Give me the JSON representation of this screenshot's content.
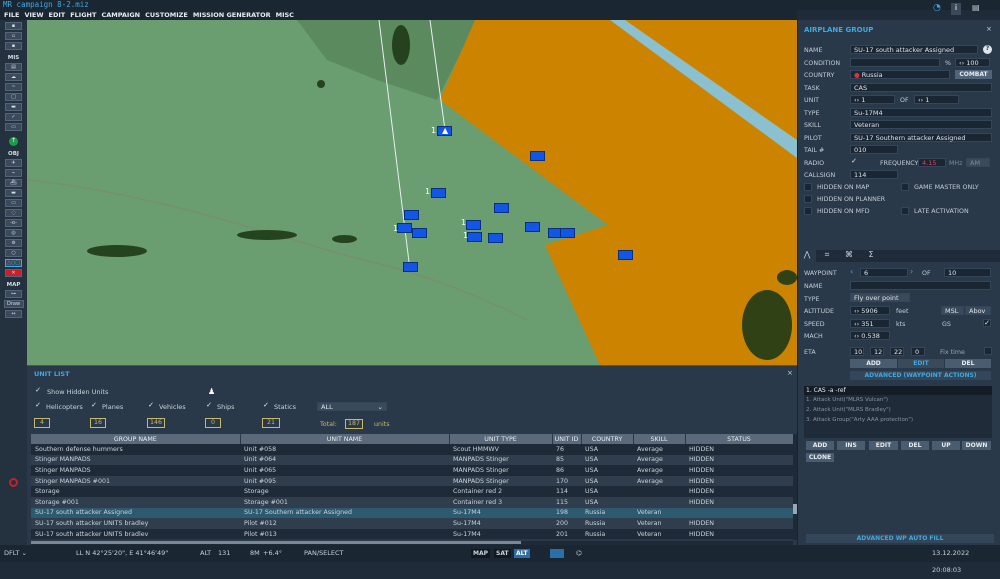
{
  "title": "MR campaign 8-2.miz",
  "menu": [
    "FILE",
    "VIEW",
    "EDIT",
    "FLIGHT",
    "CAMPAIGN",
    "CUSTOMIZE",
    "MISSION GENERATOR",
    "MISC"
  ],
  "toolbar": {
    "mis": "MIS",
    "obj": "OBJ",
    "map": "MAP",
    "draw": "Draw"
  },
  "map": {
    "marker_label": "1"
  },
  "colors": {
    "map_green": "#6a9d6f",
    "enemy_zone": "#cc8400",
    "unit_blue": "#1256e6",
    "accent": "#3fa9e0"
  },
  "unit_list": {
    "title": "UNIT LIST",
    "show_hidden": "Show Hidden Units",
    "filters": [
      {
        "label": "Helicopters",
        "count": "4"
      },
      {
        "label": "Planes",
        "count": "16"
      },
      {
        "label": "Vehicles",
        "count": "146"
      },
      {
        "label": "Ships",
        "count": "0"
      },
      {
        "label": "Statics",
        "count": "21"
      }
    ],
    "coalition_select": "ALL",
    "total_label": "Total:",
    "total": "187",
    "units_label": "units",
    "columns": [
      "GROUP NAME",
      "UNIT NAME",
      "UNIT TYPE",
      "UNIT ID",
      "COUNTRY",
      "SKILL",
      "STATUS"
    ],
    "rows": [
      [
        "Southern defense hummers",
        "Unit #058",
        "Scout HMMWV",
        "76",
        "USA",
        "Average",
        "HIDDEN"
      ],
      [
        "Stinger MANPADS",
        "Unit #064",
        "MANPADS Stinger",
        "85",
        "USA",
        "Average",
        "HIDDEN"
      ],
      [
        "Stinger MANPADS",
        "Unit #065",
        "MANPADS Stinger",
        "86",
        "USA",
        "Average",
        "HIDDEN"
      ],
      [
        "Stinger MANPADS #001",
        "Unit #095",
        "MANPADS Stinger",
        "170",
        "USA",
        "Average",
        "HIDDEN"
      ],
      [
        "Storage",
        "Storage",
        "Container red 2",
        "114",
        "USA",
        "",
        "HIDDEN"
      ],
      [
        "Storage #001",
        "Storage #001",
        "Container red 3",
        "115",
        "USA",
        "",
        "HIDDEN"
      ],
      [
        "SU-17 south attacker Assigned",
        "SU-17 Southern attacker Assigned",
        "Su-17M4",
        "198",
        "Russia",
        "Veteran",
        ""
      ],
      [
        "SU-17 south attacker UNITS  bradley",
        "Pilot #012",
        "Su-17M4",
        "200",
        "Russia",
        "Veteran",
        "HIDDEN"
      ],
      [
        "SU-17 south attacker UNITS  bradlev",
        "Pilot #013",
        "Su-17M4",
        "201",
        "Russia",
        "Veteran",
        "HIDDEN"
      ]
    ],
    "selected_row": 6
  },
  "group": {
    "title": "AIRPLANE GROUP",
    "close": "×",
    "name_label": "NAME",
    "name": "SU-17 south attacker Assigned",
    "help": "?",
    "condition_label": "CONDITION",
    "condition": "",
    "percent": "%",
    "condition_value": "100",
    "country_label": "COUNTRY",
    "country": "Russia",
    "combat": "COMBAT",
    "task_label": "TASK",
    "task": "CAS",
    "unit_label": "UNIT",
    "unit": "1",
    "of": "OF",
    "unit_total": "1",
    "type_label": "TYPE",
    "type": "Su-17M4",
    "skill_label": "SKILL",
    "skill": "Veteran",
    "pilot_label": "PILOT",
    "pilot": "SU-17 Southern attacker Assigned",
    "tail_label": "TAIL #",
    "tail": "010",
    "radio_label": "RADIO",
    "frequency_label": "FREQUENCY",
    "frequency": "4.15",
    "mhz": "MHz",
    "modulation": "AM",
    "callsign_label": "CALLSIGN",
    "callsign": "114",
    "hidden_map": "HIDDEN ON MAP",
    "gm_only": "GAME MASTER ONLY",
    "hidden_planner": "HIDDEN ON PLANNER",
    "hidden_mfd": "HIDDEN ON MFD",
    "late_activation": "LATE ACTIVATION"
  },
  "waypoint": {
    "tabs": [
      "route",
      "triggers",
      "payload",
      "summary"
    ],
    "waypoint_label": "WAYPOINT",
    "waypoint": "6",
    "of": "OF",
    "total": "10",
    "name_label": "NAME",
    "name": "",
    "type_label": "TYPE",
    "type": "Fly over point",
    "altitude_label": "ALTITUDE",
    "altitude": "5906",
    "feet": "feet",
    "alt_ref": "MSL",
    "alt_mode": "Abov",
    "speed_label": "SPEED",
    "speed": "351",
    "kts": "kts",
    "gs": "GS",
    "mach_label": "MACH",
    "mach": "0.538",
    "eta_label": "ETA",
    "eta": [
      "10",
      "12",
      "22",
      "0"
    ],
    "fix_time": "Fix time",
    "add": "ADD",
    "edit": "EDIT",
    "del": "DEL",
    "advanced": "ADVANCED (WAYPOINT ACTIONS)",
    "actions": [
      "1. CAS -a -ref",
      "1. Attack Unit(\"MLRS Vulcan\")",
      "2. Attack Unit(\"MLRS Bradley\")",
      "3. Attack Group(\"Arty AAA protection\")"
    ],
    "buttons": [
      "ADD",
      "INS",
      "EDIT",
      "DEL",
      "UP",
      "DOWN",
      "CLONE"
    ],
    "auto_fill": "ADVANCED WP AUTO FILL"
  },
  "status": {
    "layer": "DFLT",
    "coords": "LL  N 42°25'20\", E 41°46'49\"",
    "alt_label": "ALT",
    "alt": "131",
    "bm_label": "8M",
    "bm": "+6.4°",
    "mode": "PAN/SELECT",
    "map_btn": "MAP",
    "sat_btn": "SAT",
    "alt_btn": "ALT",
    "datetime": "13.12.2022 20:08:03"
  }
}
